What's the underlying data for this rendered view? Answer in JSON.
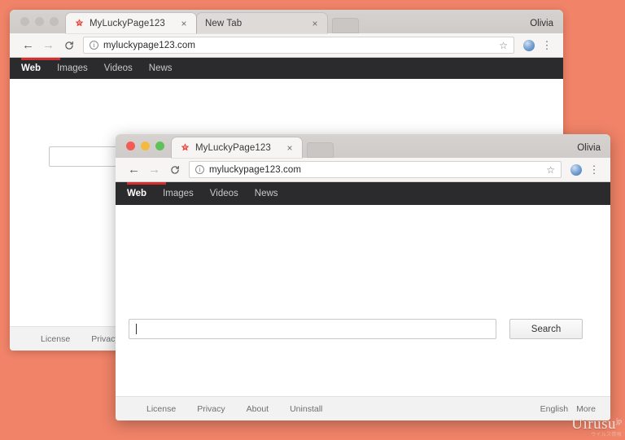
{
  "desktop": {
    "background_color": "#f08368"
  },
  "watermark": {
    "main": "Uirusu",
    "suffix": "jp",
    "sub": "ウイルス情報"
  },
  "window_back": {
    "profile_name": "Olivia",
    "tabs": [
      {
        "title": "MyLuckyPage123",
        "favicon": "red-star-favicon",
        "close": "×",
        "active": true
      },
      {
        "title": "New Tab",
        "close": "×",
        "active": false
      }
    ],
    "toolbar": {
      "back_icon": "←",
      "forward_icon": "→",
      "reload_icon": "⟳",
      "info_icon": "ⓘ",
      "url": "myluckypage123.com",
      "star_icon": "☆",
      "avatar_icon": "profile-avatar-icon",
      "menu_icon": "⋮"
    },
    "site_nav": [
      {
        "label": "Web",
        "active": true
      },
      {
        "label": "Images",
        "active": false
      },
      {
        "label": "Videos",
        "active": false
      },
      {
        "label": "News",
        "active": false
      }
    ],
    "search": {
      "value": "",
      "placeholder": ""
    },
    "footer_left": [
      "License",
      "Privacy"
    ],
    "footer_right": []
  },
  "window_front": {
    "profile_name": "Olivia",
    "tabs": [
      {
        "title": "MyLuckyPage123",
        "favicon": "red-star-favicon",
        "close": "×",
        "active": true
      }
    ],
    "toolbar": {
      "back_icon": "←",
      "forward_icon": "→",
      "reload_icon": "⟳",
      "info_icon": "ⓘ",
      "url": "myluckypage123.com",
      "star_icon": "☆",
      "avatar_icon": "profile-avatar-icon",
      "menu_icon": "⋮"
    },
    "site_nav": [
      {
        "label": "Web",
        "active": true
      },
      {
        "label": "Images",
        "active": false
      },
      {
        "label": "Videos",
        "active": false
      },
      {
        "label": "News",
        "active": false
      }
    ],
    "search": {
      "value": "",
      "placeholder": "",
      "button_label": "Search"
    },
    "footer_left": [
      "License",
      "Privacy",
      "About",
      "Uninstall"
    ],
    "footer_right": [
      "English",
      "More"
    ]
  },
  "colors": {
    "desktop": "#f08368",
    "site_nav_bg": "#2b2b2d",
    "accent_red": "#d32f2f",
    "favicon_red": "#e8453c"
  }
}
